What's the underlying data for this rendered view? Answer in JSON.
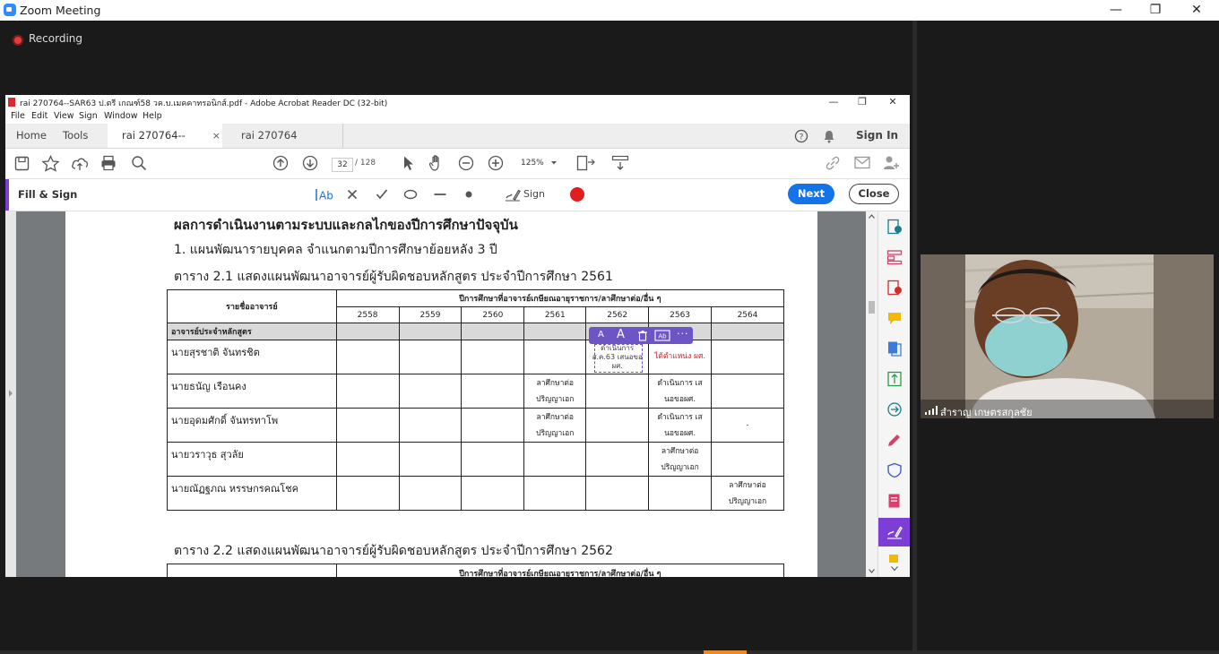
{
  "zoom": {
    "title": "Zoom Meeting",
    "recording_label": "Recording",
    "window_controls": [
      "—",
      "❐",
      "✕"
    ]
  },
  "acrobat": {
    "title": "rai 270764--SAR63 ป.ตรี เกณฑ์58 วค.บ.เมคคาทรอนิกส์.pdf - Adobe Acrobat Reader DC (32-bit)",
    "window_controls": [
      "—",
      "❐",
      "✕"
    ],
    "menu": [
      "File",
      "Edit",
      "View",
      "Sign",
      "Window",
      "Help"
    ],
    "tabs": {
      "home": "Home",
      "tools": "Tools",
      "doc1": "rai 270764--SAR63...",
      "doc1_close": "×",
      "doc2": "rai 270764 SAR63ห..."
    },
    "sign_in": "Sign In",
    "page_current": "32",
    "page_total": "/ 128",
    "zoom_level": "125%",
    "fill_sign": {
      "label": "Fill & Sign",
      "sign_label": "Sign",
      "next": "Next",
      "close": "Close",
      "color": "#e02020"
    },
    "accent_color": "#7d3ed6",
    "primary_color": "#1473e6"
  },
  "doc": {
    "heading": "ผลการดำเนินงานตามระบบและกลไกของปีการศึกษาปัจจุบัน",
    "subheading": "1.  แผนพัฒนารายบุคคล จำแนกตามปีการศึกษาย้อยหลัง 3 ปี",
    "table1_title": "ตาราง 2.1 แสดงแผนพัฒนาอาจารย์ผู้รับผิดชอบหลักสูตร ประจำปีการศึกษา 2561",
    "table2_title": "ตาราง 2.2 แสดงแผนพัฒนาอาจารย์ผู้รับผิดชอบหลักสูตร ประจำปีการศึกษา 2562",
    "col_name": "รายชื่ออาจารย์",
    "col_group": "ปีการศึกษาที่อาจารย์เกษียณอายุราชการ/ลาศึกษาต่อ/อื่น ๆ",
    "years": [
      "2558",
      "2559",
      "2560",
      "2561",
      "2562",
      "2563",
      "2564"
    ],
    "section_row": "อาจารย์ประจำหลักสูตร",
    "rows": [
      {
        "name": "นายสุรชาติ จันทรชิต",
        "cells": [
          "",
          "",
          "",
          "",
          "ดำเนินการ ส.ค.63 เสนอขอ ผศ.",
          "ได้ตำแหน่ง ผศ.",
          ""
        ]
      },
      {
        "name": "นายธนัญ เรือนคง",
        "cells": [
          "",
          "",
          "",
          "ลาศึกษาต่อ ปริญญาเอก",
          "",
          "ดำเนินการ เสนอขอผศ.",
          ""
        ]
      },
      {
        "name": "นายอุดมศักดิ์ จันทรทาโพ",
        "cells": [
          "",
          "",
          "",
          "ลาศึกษาต่อ ปริญญาเอก",
          "",
          "ดำเนินการ เสนอขอผศ.",
          "-"
        ]
      },
      {
        "name": "นายวราวุธ สุวลัย",
        "cells": [
          "",
          "",
          "",
          "",
          "",
          "ลาศึกษาต่อ ปริญญาเอก",
          ""
        ]
      },
      {
        "name": "นายณัฏฐภณ หรรษกรคณโชค",
        "cells": [
          "",
          "",
          "",
          "",
          "",
          "",
          "ลาศึกษาต่อ ปริญญาเอก"
        ]
      }
    ]
  },
  "video": {
    "participant_name": "สำราญ เกษตรสกุลชัย"
  }
}
